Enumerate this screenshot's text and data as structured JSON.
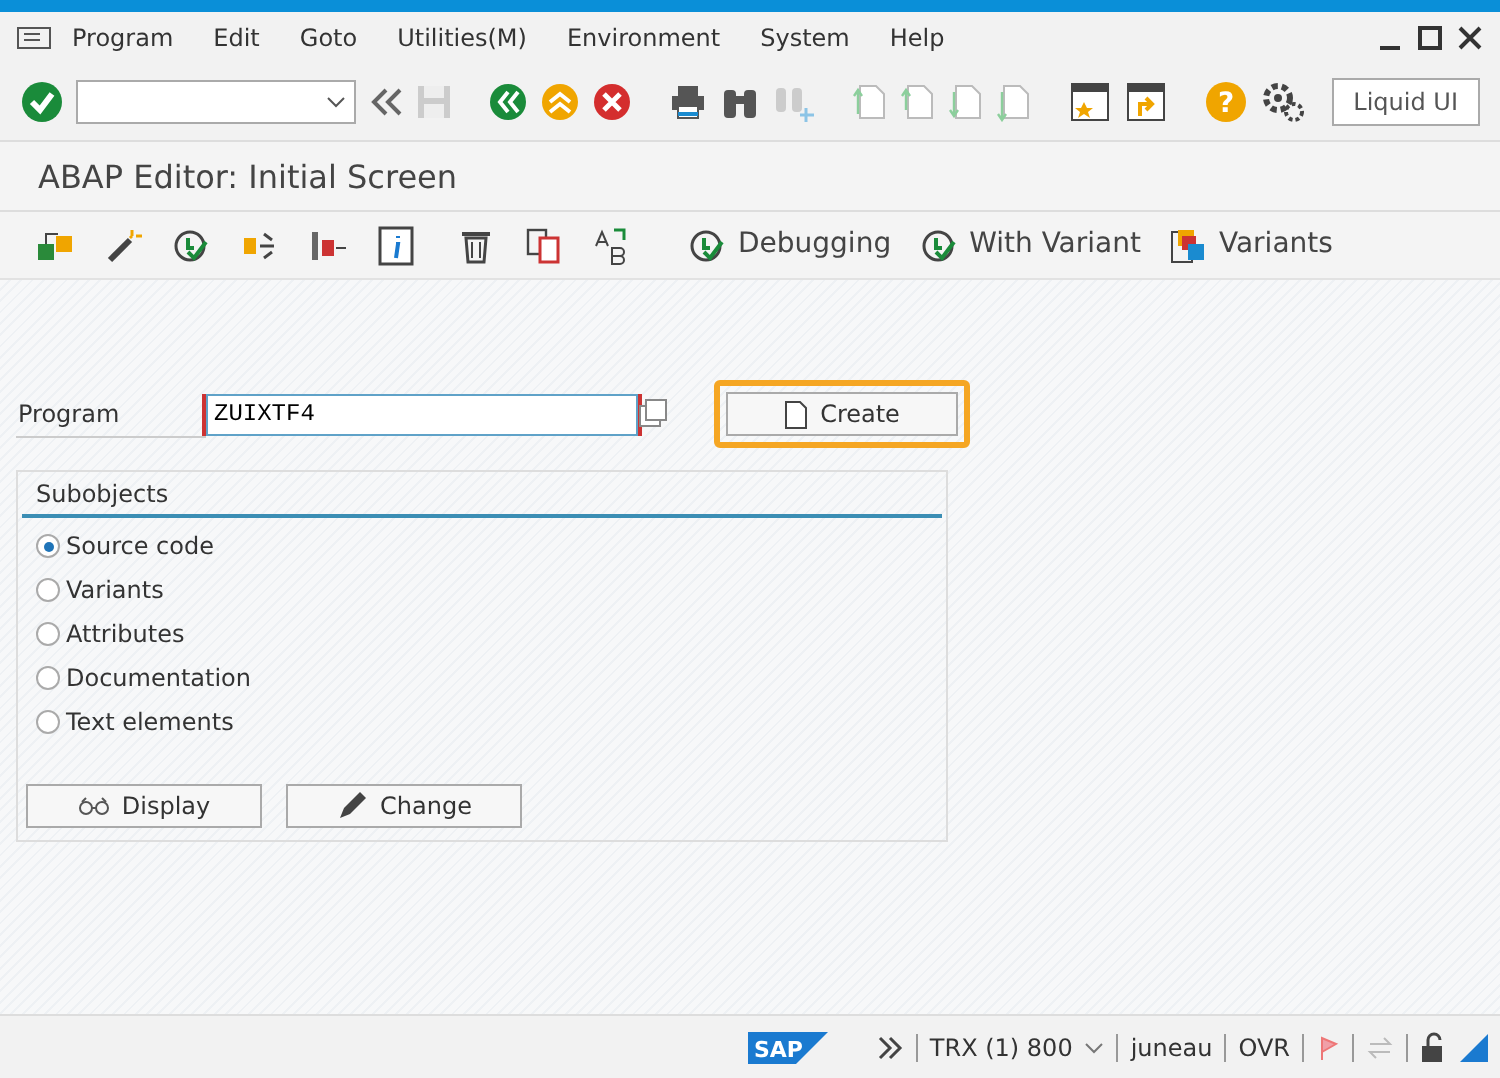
{
  "menu": [
    {
      "label": "Program"
    },
    {
      "label": "Edit"
    },
    {
      "label": "Goto"
    },
    {
      "label": "Utilities(M)"
    },
    {
      "label": "Environment"
    },
    {
      "label": "System"
    },
    {
      "label": "Help"
    }
  ],
  "toolbar": {
    "help_glyph": "?",
    "liquid_button": "Liquid UI"
  },
  "title": "ABAP Editor: Initial Screen",
  "app_toolbar": [
    {
      "label": "Debugging"
    },
    {
      "label": "With Variant"
    },
    {
      "label": "Variants"
    }
  ],
  "program": {
    "label": "Program",
    "value": "ZUIXTF4"
  },
  "create_button": {
    "label": "Create",
    "highlighted": true
  },
  "subobjects": {
    "title": "Subobjects",
    "options": [
      {
        "label": "Source code",
        "selected": true
      },
      {
        "label": "Variants",
        "selected": false
      },
      {
        "label": "Attributes",
        "selected": false
      },
      {
        "label": "Documentation",
        "selected": false
      },
      {
        "label": "Text elements",
        "selected": false
      }
    ]
  },
  "buttons": [
    {
      "label": "Display"
    },
    {
      "label": "Change"
    }
  ],
  "status_bar": {
    "logo": "SAP",
    "system": "TRX (1) 800",
    "user": "juneau",
    "mode": "OVR"
  }
}
